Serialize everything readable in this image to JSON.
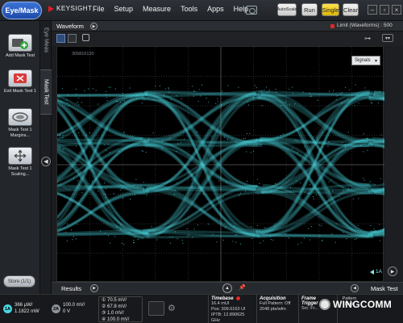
{
  "menubar": {
    "mode_button": "Eye/Mask",
    "brand": "KEYSIGHT",
    "menu_items": [
      "File",
      "Setup",
      "Measure",
      "Tools",
      "Apps",
      "Help"
    ],
    "auto_scale_line1": "Auto",
    "auto_scale_line2": "Scale",
    "run": "Run",
    "single": "Single",
    "clear": "Clear"
  },
  "left_toolbar": {
    "tools": [
      {
        "label": "Add Mask Test",
        "icon": "add-mask-icon"
      },
      {
        "label": "Exit Mask Test 1",
        "icon": "exit-mask-icon"
      },
      {
        "label": "Mask Test 1 Margins...",
        "icon": "margins-icon"
      },
      {
        "label": "Mask Test 1 Scaling...",
        "icon": "scaling-icon"
      }
    ],
    "store_button": "Store (1/1)"
  },
  "vertical_tabs": {
    "eye_meas": "Eye Meas",
    "mask_test": "Mask Test"
  },
  "waveform_header": {
    "tab": "Waveform",
    "limit_text": "Limit (Waveforms) : 500"
  },
  "display": {
    "waveform_id": "305816130",
    "signals_dropdown": "Signals",
    "channel_label": "1A",
    "trace_color": "#49d7e0"
  },
  "results_bar": {
    "results_tab": "Results",
    "mask_test_tab": "Mask Test"
  },
  "status": {
    "channel_1a": "1A",
    "channel_1a_scale": "366 µW/",
    "channel_1a_power": "1.1822 mW",
    "channel_2a": "2A",
    "channel_2a_scale": "100.0 mV/",
    "channel_2a_offset": "0 V",
    "meas_rows": [
      {
        "id": "1",
        "value": "70.5 mV/"
      },
      {
        "id": "2",
        "value": "67.8 mV/"
      },
      {
        "id": "3",
        "value": "1.0 mV/"
      },
      {
        "id": "4",
        "value": "100.0 mV/"
      }
    ],
    "timebase": {
      "title": "Timebase",
      "scale": "16.4 mUI",
      "pos": "Pos: 309.6163 UI",
      "ipttb": "IPTB: 12.890625 GHz"
    },
    "acquisition": {
      "title": "Acquisition",
      "mode": "Full Pattern: Off",
      "rate": "2048 pts/wfm"
    },
    "frame_trigger": {
      "title": "Frame Trigger",
      "src": "Src: Fr..."
    },
    "pattern_lock": {
      "line1": "Pattern",
      "line2": "Lock"
    },
    "watermark": "WINGCOMM",
    "accent_color": "#ffd400",
    "record_color": "#e02828"
  }
}
